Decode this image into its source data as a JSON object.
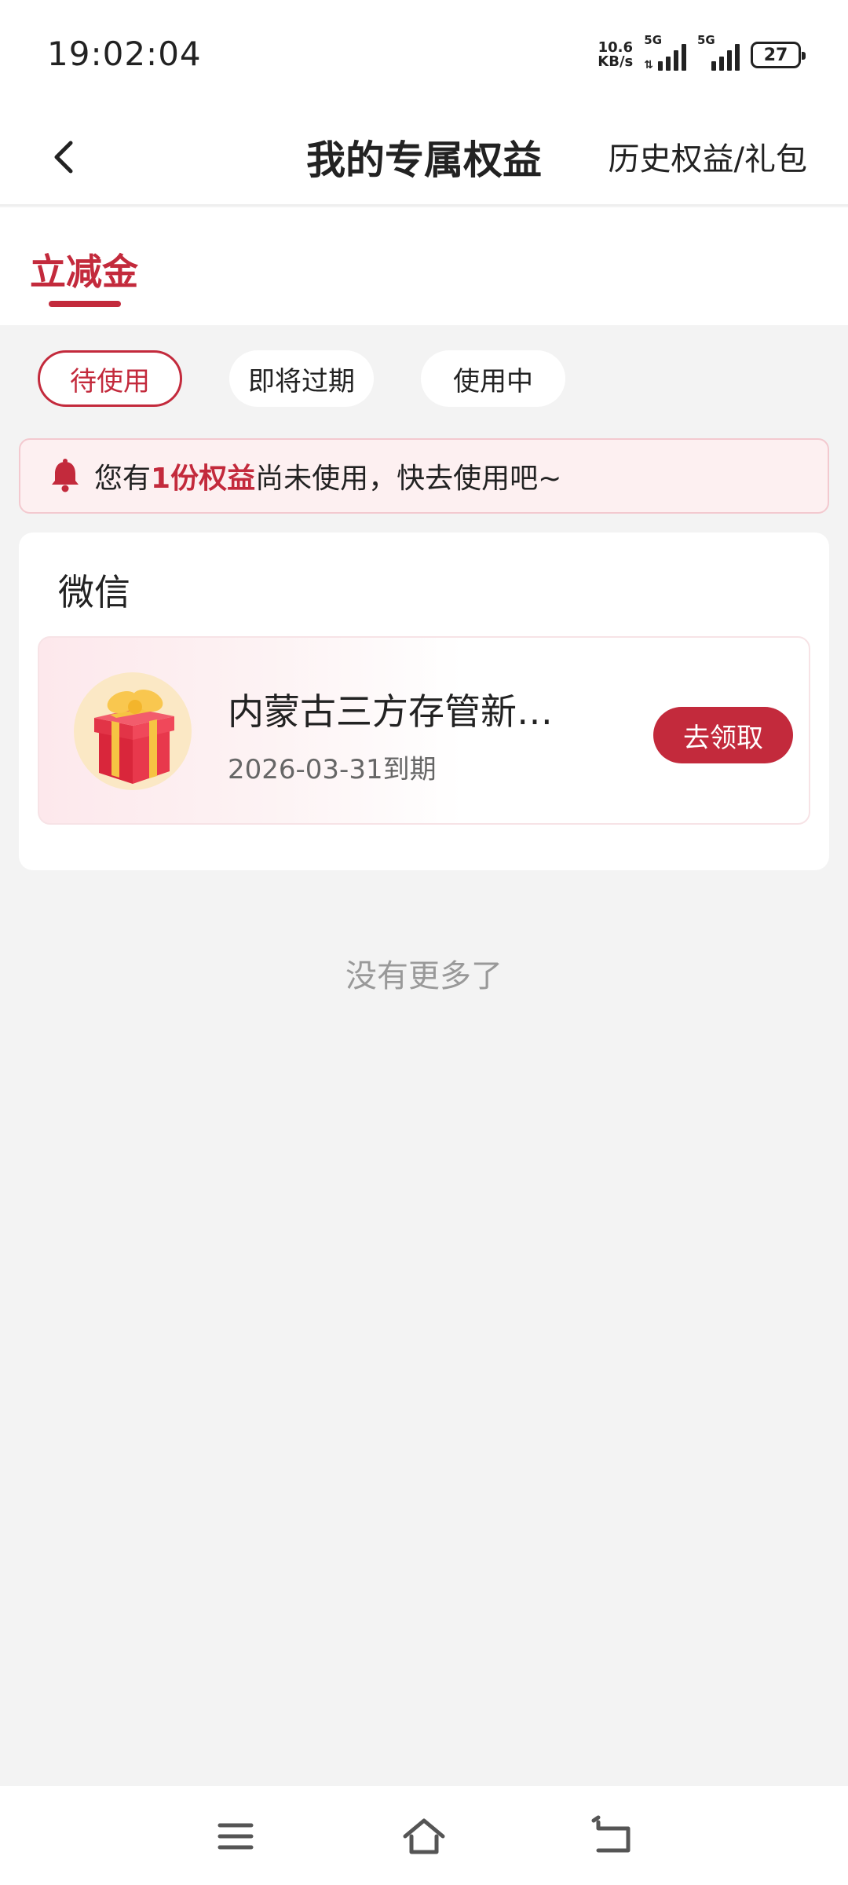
{
  "status_bar": {
    "time": "19:02:04",
    "net_speed_value": "10.6",
    "net_speed_unit": "KB/s",
    "sim1_label": "5G",
    "sim2_label": "5G",
    "battery": "27"
  },
  "nav": {
    "back_icon": "chevron-left-icon",
    "title": "我的专属权益",
    "right_link": "历史权益/礼包"
  },
  "tabs": {
    "active": "立减金"
  },
  "filters": [
    {
      "label": "待使用",
      "active": true
    },
    {
      "label": "即将过期",
      "active": false
    },
    {
      "label": "使用中",
      "active": false
    }
  ],
  "notice": {
    "icon": "bell-icon",
    "prefix": "您有",
    "highlight": "1份权益",
    "suffix": "尚未使用，快去使用吧~"
  },
  "section": {
    "title": "微信",
    "items": [
      {
        "icon": "gift-icon",
        "name": "内蒙古三方存管新…",
        "expiry": "2026-03-31到期",
        "button": "去领取"
      }
    ]
  },
  "footer_text": "没有更多了",
  "system_nav": {
    "menu_icon": "menu-icon",
    "home_icon": "home-icon",
    "back_icon": "back-icon"
  },
  "colors": {
    "accent": "#c32a3c",
    "page_bg": "#f3f3f3",
    "notice_bg": "#fdf0f1"
  }
}
